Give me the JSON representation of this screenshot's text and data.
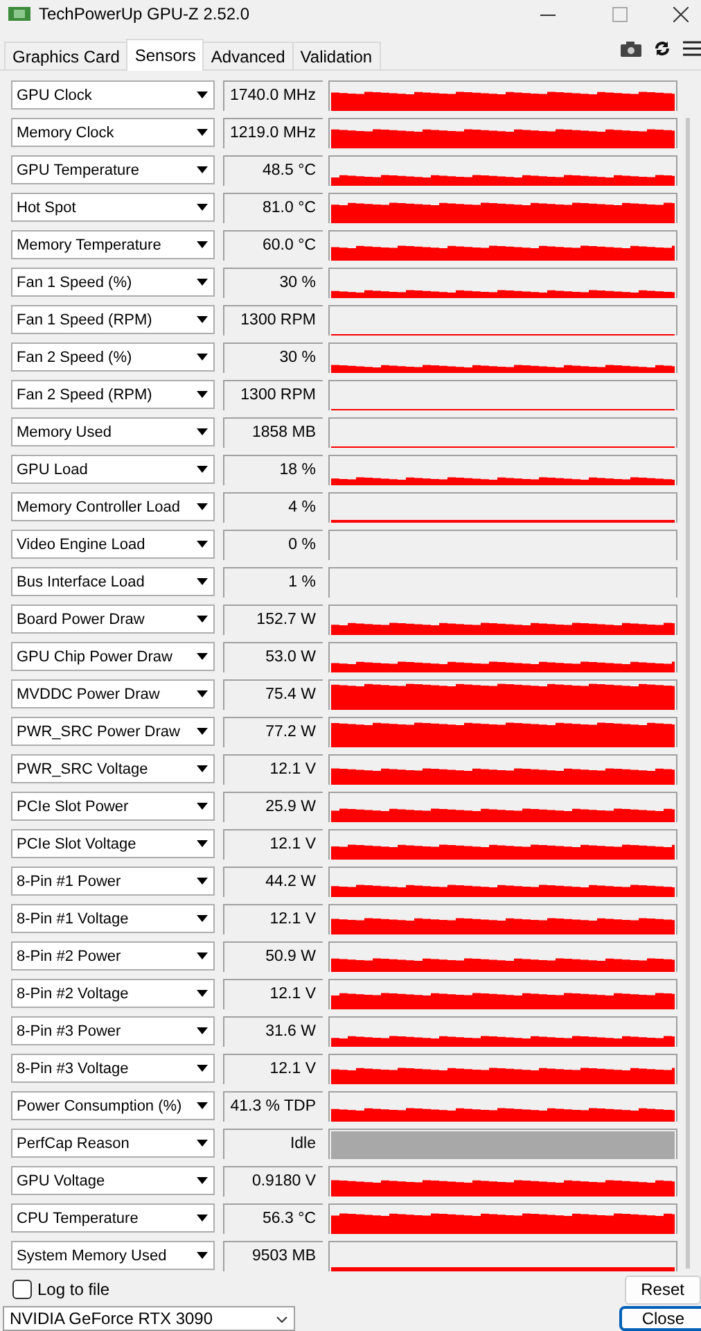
{
  "window": {
    "title": "TechPowerUp GPU-Z 2.52.0"
  },
  "tabs": [
    {
      "label": "Graphics Card",
      "selected": false
    },
    {
      "label": "Sensors",
      "selected": true
    },
    {
      "label": "Advanced",
      "selected": false
    },
    {
      "label": "Validation",
      "selected": false
    }
  ],
  "sensors": [
    {
      "name": "GPU Clock",
      "value": "1740.0 MHz",
      "kind": "trace"
    },
    {
      "name": "Memory Clock",
      "value": "1219.0 MHz",
      "kind": "trace"
    },
    {
      "name": "GPU Temperature",
      "value": "48.5 °C",
      "kind": "trace"
    },
    {
      "name": "Hot Spot",
      "value": "81.0 °C",
      "kind": "trace"
    },
    {
      "name": "Memory Temperature",
      "value": "60.0 °C",
      "kind": "trace"
    },
    {
      "name": "Fan 1 Speed (%)",
      "value": "30 %",
      "kind": "trace"
    },
    {
      "name": "Fan 1 Speed (RPM)",
      "value": "1300 RPM",
      "kind": "trace"
    },
    {
      "name": "Fan 2 Speed (%)",
      "value": "30 %",
      "kind": "trace"
    },
    {
      "name": "Fan 2 Speed (RPM)",
      "value": "1300 RPM",
      "kind": "trace"
    },
    {
      "name": "Memory Used",
      "value": "1858 MB",
      "kind": "trace"
    },
    {
      "name": "GPU Load",
      "value": "18 %",
      "kind": "trace"
    },
    {
      "name": "Memory Controller Load",
      "value": "4 %",
      "kind": "trace"
    },
    {
      "name": "Video Engine Load",
      "value": "0 %",
      "kind": "empty"
    },
    {
      "name": "Bus Interface Load",
      "value": "1 %",
      "kind": "empty"
    },
    {
      "name": "Board Power Draw",
      "value": "152.7 W",
      "kind": "trace"
    },
    {
      "name": "GPU Chip Power Draw",
      "value": "53.0 W",
      "kind": "trace"
    },
    {
      "name": "MVDDC Power Draw",
      "value": "75.4 W",
      "kind": "trace"
    },
    {
      "name": "PWR_SRC Power Draw",
      "value": "77.2 W",
      "kind": "trace"
    },
    {
      "name": "PWR_SRC Voltage",
      "value": "12.1 V",
      "kind": "trace"
    },
    {
      "name": "PCIe Slot Power",
      "value": "25.9 W",
      "kind": "trace"
    },
    {
      "name": "PCIe Slot Voltage",
      "value": "12.1 V",
      "kind": "trace"
    },
    {
      "name": "8-Pin #1 Power",
      "value": "44.2 W",
      "kind": "trace"
    },
    {
      "name": "8-Pin #1 Voltage",
      "value": "12.1 V",
      "kind": "trace"
    },
    {
      "name": "8-Pin #2 Power",
      "value": "50.9 W",
      "kind": "trace"
    },
    {
      "name": "8-Pin #2 Voltage",
      "value": "12.1 V",
      "kind": "trace"
    },
    {
      "name": "8-Pin #3 Power",
      "value": "31.6 W",
      "kind": "trace"
    },
    {
      "name": "8-Pin #3 Voltage",
      "value": "12.1 V",
      "kind": "trace"
    },
    {
      "name": "Power Consumption (%)",
      "value": "41.3 % TDP",
      "kind": "trace"
    },
    {
      "name": "PerfCap Reason",
      "value": "Idle",
      "kind": "band"
    },
    {
      "name": "GPU Voltage",
      "value": "0.9180 V",
      "kind": "trace"
    },
    {
      "name": "CPU Temperature",
      "value": "56.3 °C",
      "kind": "trace"
    },
    {
      "name": "System Memory Used",
      "value": "9503 MB",
      "kind": "trace"
    }
  ],
  "log_to_file": {
    "label": "Log to file",
    "checked": false
  },
  "reset_button": "Reset",
  "gpu_select": {
    "value": "NVIDIA GeForce RTX 3090"
  },
  "close_button": "Close"
}
